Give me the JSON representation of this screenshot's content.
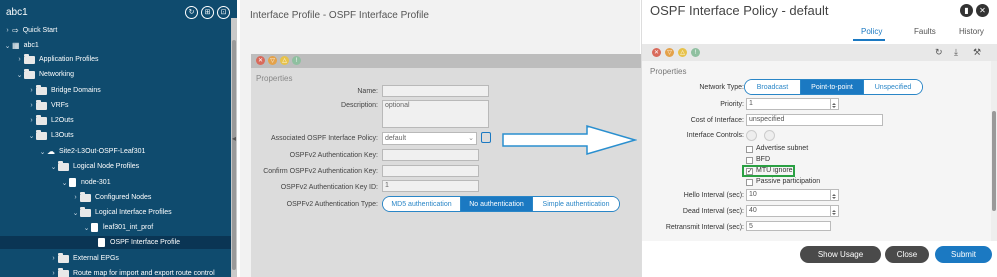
{
  "sidebar": {
    "title": "abc1",
    "items": [
      {
        "label": "Quick Start"
      },
      {
        "label": "abc1"
      },
      {
        "label": "Application Profiles"
      },
      {
        "label": "Networking"
      },
      {
        "label": "Bridge Domains"
      },
      {
        "label": "VRFs"
      },
      {
        "label": "L2Outs"
      },
      {
        "label": "L3Outs"
      },
      {
        "label": "Site2-L3Out-OSPF-Leaf301"
      },
      {
        "label": "Logical Node Profiles"
      },
      {
        "label": "node-301"
      },
      {
        "label": "Configured Nodes"
      },
      {
        "label": "Logical Interface Profiles"
      },
      {
        "label": "leaf301_int_prof"
      },
      {
        "label": "OSPF Interface Profile"
      },
      {
        "label": "External EPGs"
      },
      {
        "label": "Route map for import and export route control"
      }
    ]
  },
  "mid": {
    "title": "Interface Profile - OSPF Interface Profile",
    "properties_label": "Properties",
    "name_label": "Name:",
    "description_label": "Description:",
    "description_placeholder": "optional",
    "policy_label": "Associated OSPF Interface Policy:",
    "policy_value": "default",
    "authkey_label": "OSPFv2 Authentication Key:",
    "confirm_label": "Confirm OSPFv2 Authentication Key:",
    "keyid_label": "OSPFv2 Authentication Key ID:",
    "keyid_value": "1",
    "authtype_label": "OSPFv2 Authentication Type:",
    "authtype_options": [
      "MD5 authentication",
      "No authentication",
      "Simple authentication"
    ]
  },
  "dialog": {
    "title": "OSPF Interface Policy - default",
    "tabs": [
      "Policy",
      "Faults",
      "History"
    ],
    "properties_label": "Properties",
    "network_type_label": "Network Type:",
    "network_type_options": [
      "Broadcast",
      "Point-to-point",
      "Unspecified"
    ],
    "priority_label": "Priority:",
    "priority_value": "1",
    "cost_label": "Cost of Interface:",
    "cost_value": "unspecified",
    "controls_label": "Interface Controls:",
    "controls": [
      "Advertise subnet",
      "BFD",
      "MTU ignore",
      "Passive participation"
    ],
    "hello_label": "Hello Interval (sec):",
    "hello_value": "10",
    "dead_label": "Dead Interval (sec):",
    "dead_value": "40",
    "retransmit_label": "Retransmit Interval (sec):",
    "retransmit_value": "5",
    "buttons": {
      "show_usage": "Show Usage",
      "close": "Close",
      "submit": "Submit"
    }
  },
  "colors": {
    "sidebar": "#0f4b6e",
    "accent": "#1b79c2",
    "highlight": "#2aa043"
  }
}
